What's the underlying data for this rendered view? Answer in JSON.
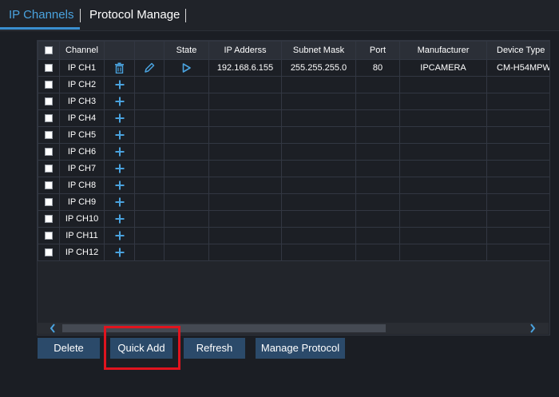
{
  "tabs": [
    {
      "label": "IP Channels",
      "active": true
    },
    {
      "label": "Protocol Manage",
      "active": false
    }
  ],
  "table": {
    "headers": {
      "checkbox": "",
      "channel": "Channel",
      "delete": "",
      "edit": "",
      "state": "State",
      "ip": "IP Adderss",
      "mask": "Subnet Mask",
      "port": "Port",
      "manufacturer": "Manufacturer",
      "device_type": "Device Type"
    },
    "rows": [
      {
        "channel": "IP CH1",
        "ip": "192.168.6.155",
        "mask": "255.255.255.0",
        "port": "80",
        "manufacturer": "IPCAMERA",
        "device_type": "CM-H54MPW",
        "configured": true
      },
      {
        "channel": "IP CH2",
        "ip": "",
        "mask": "",
        "port": "",
        "manufacturer": "",
        "device_type": "",
        "configured": false
      },
      {
        "channel": "IP CH3",
        "ip": "",
        "mask": "",
        "port": "",
        "manufacturer": "",
        "device_type": "",
        "configured": false
      },
      {
        "channel": "IP CH4",
        "ip": "",
        "mask": "",
        "port": "",
        "manufacturer": "",
        "device_type": "",
        "configured": false
      },
      {
        "channel": "IP CH5",
        "ip": "",
        "mask": "",
        "port": "",
        "manufacturer": "",
        "device_type": "",
        "configured": false
      },
      {
        "channel": "IP CH6",
        "ip": "",
        "mask": "",
        "port": "",
        "manufacturer": "",
        "device_type": "",
        "configured": false
      },
      {
        "channel": "IP CH7",
        "ip": "",
        "mask": "",
        "port": "",
        "manufacturer": "",
        "device_type": "",
        "configured": false
      },
      {
        "channel": "IP CH8",
        "ip": "",
        "mask": "",
        "port": "",
        "manufacturer": "",
        "device_type": "",
        "configured": false
      },
      {
        "channel": "IP CH9",
        "ip": "",
        "mask": "",
        "port": "",
        "manufacturer": "",
        "device_type": "",
        "configured": false
      },
      {
        "channel": "IP CH10",
        "ip": "",
        "mask": "",
        "port": "",
        "manufacturer": "",
        "device_type": "",
        "configured": false
      },
      {
        "channel": "IP CH11",
        "ip": "",
        "mask": "",
        "port": "",
        "manufacturer": "",
        "device_type": "",
        "configured": false
      },
      {
        "channel": "IP CH12",
        "ip": "",
        "mask": "",
        "port": "",
        "manufacturer": "",
        "device_type": "",
        "configured": false
      }
    ]
  },
  "buttons": {
    "delete": "Delete",
    "quick_add": "Quick Add",
    "refresh": "Refresh",
    "manage_protocol": "Manage Protocol"
  },
  "icons": {
    "trash": "trash-icon",
    "edit": "pencil-icon",
    "play": "play-icon",
    "add": "plus-icon",
    "scroll_left": "chevron-left-icon",
    "scroll_right": "chevron-right-icon"
  },
  "colors": {
    "accent": "#4aa3df",
    "button": "#2b4a6a",
    "highlight": "#e0141e"
  }
}
